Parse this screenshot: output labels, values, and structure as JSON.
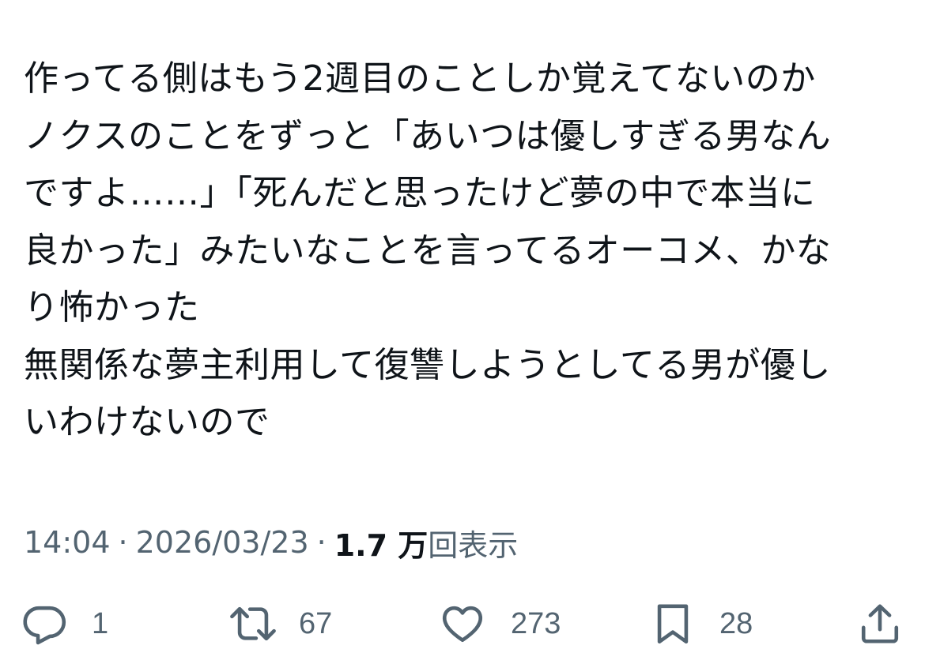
{
  "tweet": {
    "lines": [
      "作ってる側はもう2週目のことしか覚えてないのか",
      "ノクスのことをずっと「あいつは優しすぎる男なん",
      "ですよ……」「死んだと思ったけど夢の中で本当に",
      "良かった」みたいなことを言ってるオーコメ、かな",
      "り怖かった",
      "無関係な夢主利用して復讐しようとしてる男が優し",
      "いわけないので"
    ]
  },
  "meta": {
    "time": "14:04",
    "separator": "·",
    "date": "2026/03/23",
    "views_count": "1.7 万",
    "views_label": "回表示"
  },
  "actions": {
    "reply": {
      "icon": "reply-icon",
      "count": "1"
    },
    "retweet": {
      "icon": "retweet-icon",
      "count": "67"
    },
    "like": {
      "icon": "heart-icon",
      "count": "273"
    },
    "bookmark": {
      "icon": "bookmark-icon",
      "count": "28"
    },
    "share": {
      "icon": "share-icon"
    }
  },
  "colors": {
    "text": "#0f1419",
    "secondary": "#536471",
    "background": "#ffffff"
  }
}
